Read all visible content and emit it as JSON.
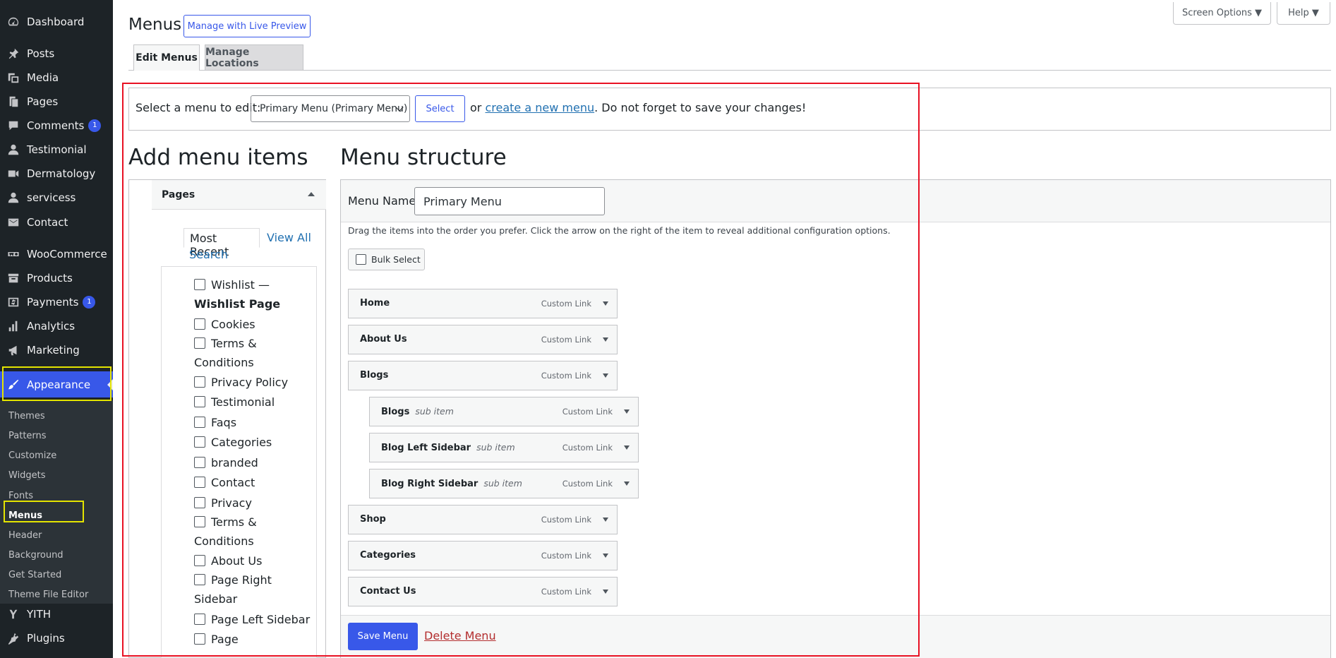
{
  "sidebar": {
    "items": [
      {
        "label": "Dashboard",
        "icon": "dashboard-icon"
      },
      {
        "label": "Posts",
        "icon": "pin-icon"
      },
      {
        "label": "Media",
        "icon": "media-icon"
      },
      {
        "label": "Pages",
        "icon": "pages-icon"
      },
      {
        "label": "Comments",
        "icon": "comment-icon",
        "badge": "1"
      },
      {
        "label": "Testimonial",
        "icon": "person-icon"
      },
      {
        "label": "Dermatology",
        "icon": "video-icon"
      },
      {
        "label": "servicess",
        "icon": "person-icon"
      },
      {
        "label": "Contact",
        "icon": "mail-icon"
      },
      {
        "label": "WooCommerce",
        "icon": "woocommerce-icon"
      },
      {
        "label": "Products",
        "icon": "archive-icon"
      },
      {
        "label": "Payments",
        "icon": "dollar-icon",
        "badge": "1"
      },
      {
        "label": "Analytics",
        "icon": "bar-chart-icon"
      },
      {
        "label": "Marketing",
        "icon": "megaphone-icon"
      },
      {
        "label": "Appearance",
        "icon": "brush-icon"
      },
      {
        "label": "YITH",
        "icon": "yith-icon"
      },
      {
        "label": "Plugins",
        "icon": "plug-icon"
      }
    ],
    "submenu": [
      "Themes",
      "Patterns",
      "Customize",
      "Widgets",
      "Fonts",
      "Menus",
      "Header",
      "Background",
      "Get Started",
      "Theme File Editor"
    ]
  },
  "header": {
    "title": "Menus",
    "live_preview": "Manage with Live Preview",
    "screen_options": "Screen Options ▼",
    "help": "Help ▼"
  },
  "tabs": [
    "Edit Menus",
    "Manage Locations"
  ],
  "select_bar": {
    "prompt": "Select a menu to edit:",
    "selected": "Primary Menu (Primary Menu)",
    "select_button": "Select",
    "or": "or",
    "create_link": "create a new menu",
    "reminder": ". Do not forget to save your changes!"
  },
  "add_items": {
    "heading": "Add menu items",
    "accordion": "Pages",
    "tab_recent": "Most Recent",
    "tab_all": "View All",
    "tab_search": "Search",
    "pages": [
      {
        "line1": "Wishlist —",
        "line2": "Wishlist Page"
      },
      {
        "line1": "Cookies"
      },
      {
        "line1": "Terms &",
        "line2": "Conditions"
      },
      {
        "line1": "Privacy Policy"
      },
      {
        "line1": "Testimonial"
      },
      {
        "line1": "Faqs"
      },
      {
        "line1": "Categories"
      },
      {
        "line1": "branded"
      },
      {
        "line1": "Contact"
      },
      {
        "line1": "Privacy"
      },
      {
        "line1": "Terms &",
        "line2": "Conditions"
      },
      {
        "line1": "About Us"
      },
      {
        "line1": "Page Right",
        "line2": "Sidebar"
      },
      {
        "line1": "Page Left Sidebar"
      },
      {
        "line1": "Page"
      }
    ]
  },
  "structure": {
    "heading": "Menu structure",
    "name_label": "Menu Name",
    "name_value": "Primary Menu",
    "instructions": "Drag the items into the order you prefer. Click the arrow on the right of the item to reveal additional configuration options.",
    "bulk_select": "Bulk Select",
    "items": [
      {
        "title": "Home",
        "type": "Custom Link",
        "sub": ""
      },
      {
        "title": "About Us",
        "type": "Custom Link",
        "sub": ""
      },
      {
        "title": "Blogs",
        "type": "Custom Link",
        "sub": ""
      },
      {
        "title": "Blogs",
        "type": "Custom Link",
        "sub": "sub item"
      },
      {
        "title": "Blog Left Sidebar",
        "type": "Custom Link",
        "sub": "sub item"
      },
      {
        "title": "Blog Right Sidebar",
        "type": "Custom Link",
        "sub": "sub item"
      },
      {
        "title": "Shop",
        "type": "Custom Link",
        "sub": ""
      },
      {
        "title": "Categories",
        "type": "Custom Link",
        "sub": ""
      },
      {
        "title": "Contact Us",
        "type": "Custom Link",
        "sub": ""
      }
    ],
    "save": "Save Menu",
    "delete": "Delete Menu"
  },
  "colors": {
    "accent": "#3858e9",
    "sidebar_bg": "#1d2327",
    "annotation_red": "#e81123",
    "annotation_yellow": "#e4e400"
  }
}
